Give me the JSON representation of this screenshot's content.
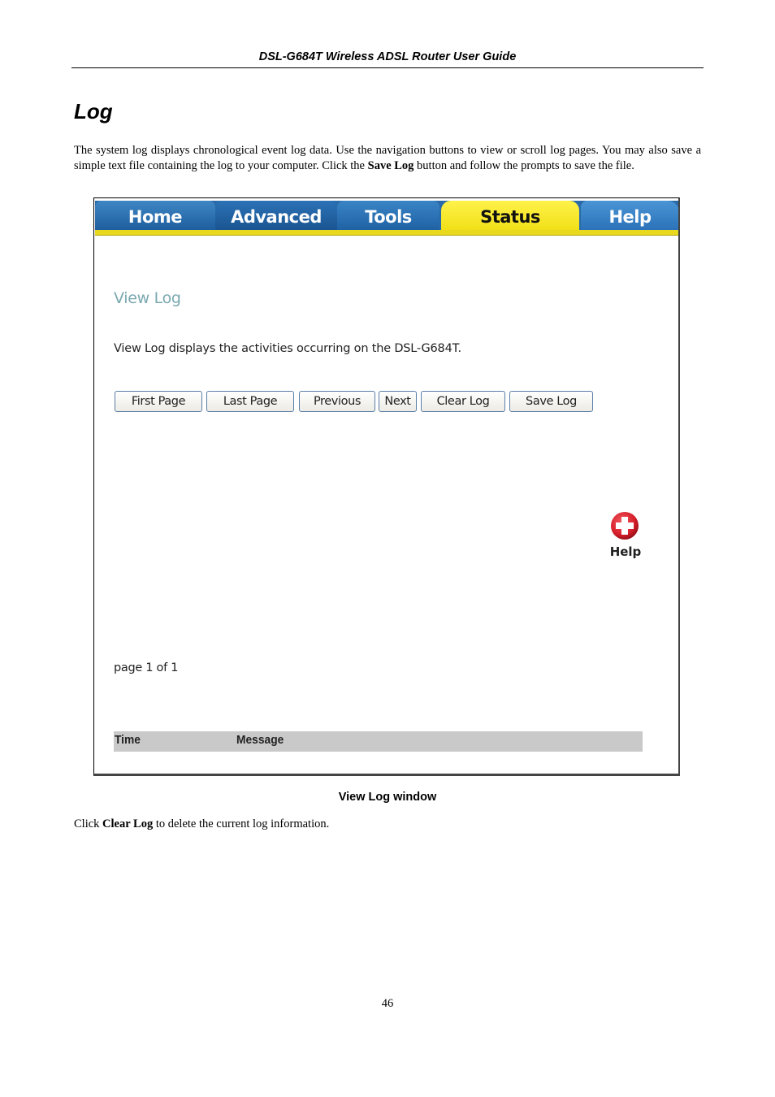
{
  "document": {
    "running_header": "DSL-G684T Wireless ADSL Router User Guide",
    "section_title": "Log",
    "intro": {
      "part1": "The system log displays chronological event log data. Use the navigation buttons to view or scroll log pages. You may also save a simple text file containing the log to your computer. Click the ",
      "bold": "Save Log",
      "part2": " button and follow the prompts to save the file."
    },
    "caption": "View Log window",
    "after": {
      "part1": "Click ",
      "bold": "Clear Log",
      "part2": " to delete the current log information."
    },
    "page_number": "46"
  },
  "router_ui": {
    "tabs": [
      {
        "label": "Home",
        "active": false
      },
      {
        "label": "Advanced",
        "active": false
      },
      {
        "label": "Tools",
        "active": false
      },
      {
        "label": "Status",
        "active": true
      },
      {
        "label": "Help",
        "active": false
      }
    ],
    "view_title": "View Log",
    "description": "View Log displays the activities occurring on the DSL-G684T.",
    "buttons": {
      "first_page": "First Page",
      "last_page": "Last Page",
      "previous": "Previous",
      "next": "Next",
      "clear_log": "Clear Log",
      "save_log": "Save Log"
    },
    "help": {
      "icon": "help-plus-icon",
      "label": "Help"
    },
    "page_indicator": "page 1 of 1",
    "log_table": {
      "columns": [
        "Time",
        "Message"
      ],
      "rows": []
    },
    "colors": {
      "tab_blue": "#2a6aa8",
      "tab_active_yellow": "#f1e018",
      "view_title": "#7aa8b0",
      "help_red": "#d8202c",
      "table_header_bg": "#c9c9c9"
    }
  }
}
